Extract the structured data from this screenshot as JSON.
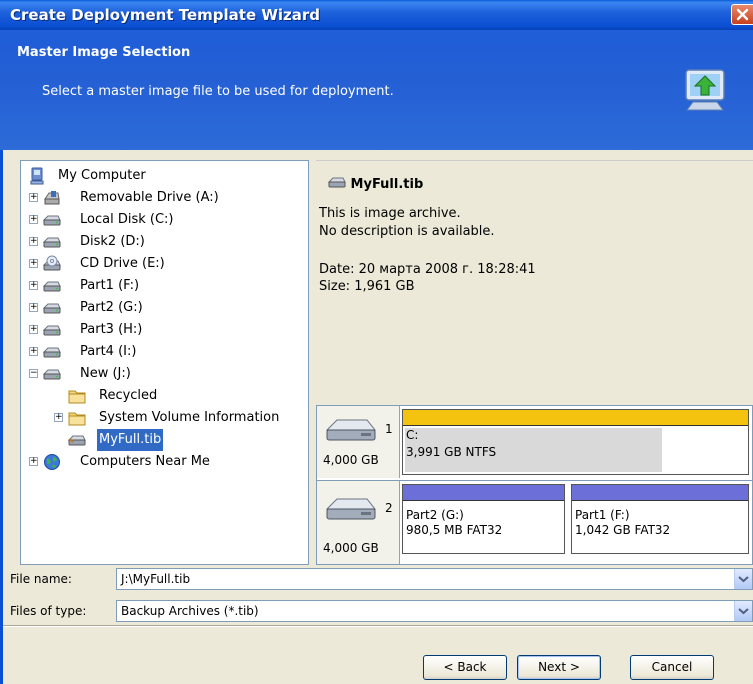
{
  "window": {
    "title": "Create Deployment Template Wizard"
  },
  "header": {
    "title": "Master Image Selection",
    "subtitle": "Select a master image file to be used for deployment."
  },
  "tree": {
    "root": "My Computer",
    "items": [
      {
        "label": "Removable Drive (A:)",
        "icon": "floppy-drive-icon"
      },
      {
        "label": "Local Disk (C:)",
        "icon": "hard-disk-icon"
      },
      {
        "label": "Disk2 (D:)",
        "icon": "hard-disk-icon"
      },
      {
        "label": "CD Drive (E:)",
        "icon": "cd-drive-icon"
      },
      {
        "label": "Part1 (F:)",
        "icon": "hard-disk-icon"
      },
      {
        "label": "Part2 (G:)",
        "icon": "hard-disk-icon"
      },
      {
        "label": "Part3 (H:)",
        "icon": "hard-disk-icon"
      },
      {
        "label": "Part4 (I:)",
        "icon": "hard-disk-icon"
      },
      {
        "label": "New (J:)",
        "icon": "hard-disk-icon"
      }
    ],
    "children": [
      {
        "label": "Recycled",
        "icon": "folder-icon"
      },
      {
        "label": "System Volume Information",
        "icon": "folder-icon"
      },
      {
        "label": "MyFull.tib",
        "icon": "archive-file-icon"
      }
    ],
    "network": "Computers Near Me"
  },
  "info": {
    "filename": "MyFull.tib",
    "line1": "This is image archive.",
    "line2": "No description is available.",
    "date": "Date: 20 марта 2008 г. 18:28:41",
    "size": "Size: 1,961 GB"
  },
  "disks": [
    {
      "number": "1",
      "size": "4,000 GB",
      "partitions": [
        {
          "name": "C:",
          "fs": "3,991 GB  NTFS",
          "color": "#f4c30f"
        }
      ]
    },
    {
      "number": "2",
      "size": "4,000 GB",
      "partitions": [
        {
          "name": "Part2 (G:)",
          "fs": "980,5 MB  FAT32",
          "color": "#6c6fd8"
        },
        {
          "name": "Part1 (F:)",
          "fs": "1,042 GB  FAT32",
          "color": "#6c6fd8"
        }
      ]
    }
  ],
  "form": {
    "filename_label": "File name:",
    "filename_value": "J:\\MyFull.tib",
    "filetype_label": "Files of type:",
    "filetype_value": "Backup Archives (*.tib)"
  },
  "buttons": {
    "back": "< Back",
    "next": "Next >",
    "cancel": "Cancel"
  },
  "colors": {
    "titlebar": "#0a4ed2",
    "header": "#245fd4",
    "selection": "#316ac5"
  }
}
